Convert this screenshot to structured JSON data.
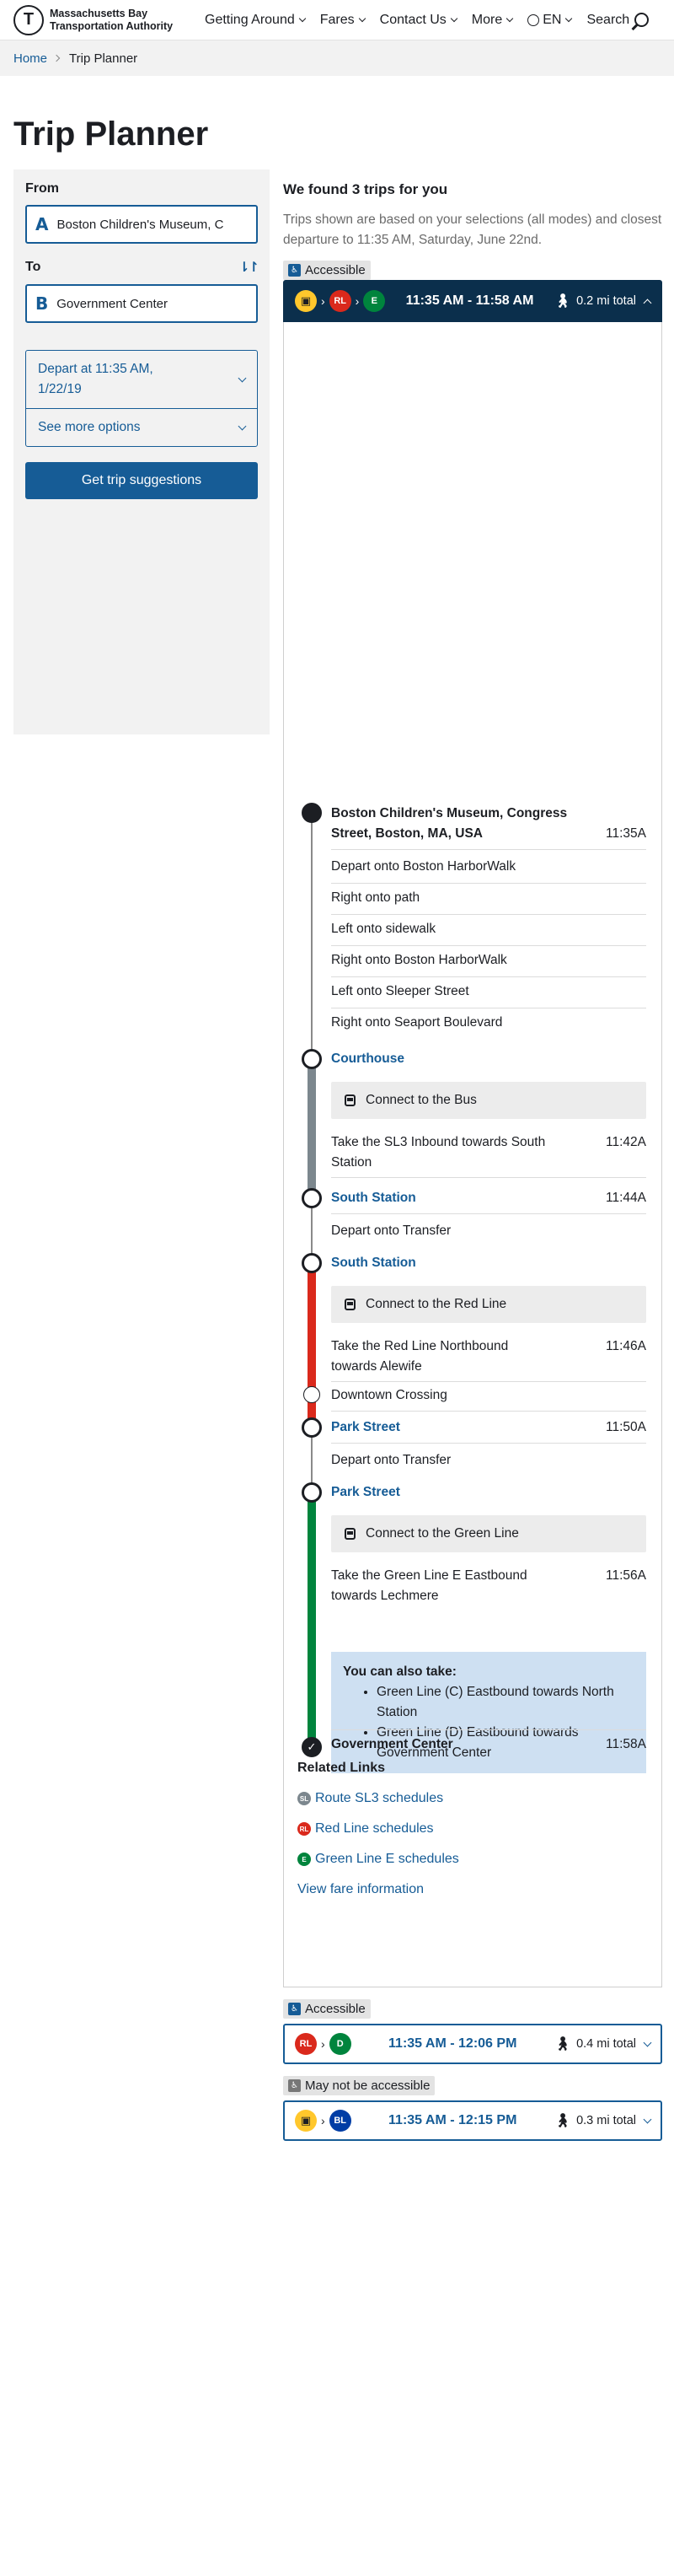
{
  "header": {
    "agency": "Massachusetts Bay Transportation Authority",
    "logo_letter": "T",
    "nav": [
      "Getting Around",
      "Fares",
      "Contact Us",
      "More"
    ],
    "lang": "EN",
    "search": "Search"
  },
  "breadcrumb": {
    "home": "Home",
    "current": "Trip Planner"
  },
  "page_title": "Trip Planner",
  "form": {
    "from_label": "From",
    "from_letter": "A",
    "from_value": "Boston Children's Museum, C",
    "to_label": "To",
    "swap": "⇂↾",
    "to_letter": "B",
    "to_value": "Government Center",
    "depart": "Depart at 11:35 AM, 1/22/19",
    "more_options": "See more options",
    "submit": "Get trip suggestions"
  },
  "results": {
    "title": "We found 3 trips for you",
    "description": "Trips shown are based on your selections (all modes) and closest departure to 11:35 AM, Saturday, June 22nd.",
    "trips": [
      {
        "accessibility": "Accessible",
        "modes": [
          "bus",
          "RL",
          "E"
        ],
        "time": "11:35 AM - 11:58 AM",
        "walk": "0.2 mi total"
      },
      {
        "accessibility": "Accessible",
        "modes": [
          "RL",
          "D"
        ],
        "time": "11:35 AM - 12:06 PM",
        "walk": "0.4 mi total"
      },
      {
        "accessibility": "May not be accessible",
        "modes": [
          "bus",
          "BL"
        ],
        "time": "11:35 AM - 12:15 PM",
        "walk": "0.3 mi total"
      }
    ]
  },
  "itinerary": {
    "origin": {
      "name": "Boston Children's Museum, Congress Street, Boston, MA, USA",
      "time": "11:35A"
    },
    "walk_steps": [
      "Depart onto Boston HarborWalk",
      "Right onto path",
      "Left onto sidewalk",
      "Right onto Boston HarborWalk",
      "Left onto Sleeper Street",
      "Right onto Seaport Boulevard"
    ],
    "courthouse": "Courthouse",
    "connect_bus": "Connect to the Bus",
    "bus_step": {
      "text": "Take the SL3 Inbound towards South Station",
      "time": "11:42A"
    },
    "south_station_1": {
      "name": "South Station",
      "time": "11:44A"
    },
    "transfer_1": "Depart onto Transfer",
    "south_station_2": "South Station",
    "connect_red": "Connect to the Red Line",
    "red_step": {
      "text": "Take the Red Line Northbound towards Alewife",
      "time": "11:46A"
    },
    "downtown": "Downtown Crossing",
    "park_street_1": {
      "name": "Park Street",
      "time": "11:50A"
    },
    "transfer_2": "Depart onto Transfer",
    "park_street_2": "Park Street",
    "connect_green": "Connect to the Green Line",
    "green_step": {
      "text": "Take the Green Line E Eastbound towards Lechmere",
      "time": "11:56A"
    },
    "also_title": "You can also take:",
    "also_items": [
      "Green Line (C) Eastbound towards North Station",
      "Green Line (D) Eastbound towards Government Center"
    ],
    "destination": {
      "name": "Government Center",
      "time": "11:58A"
    }
  },
  "related": {
    "title": "Related Links",
    "links": [
      "Route SL3 schedules",
      "Red Line schedules",
      "Green Line E schedules",
      "View fare information"
    ]
  },
  "colors": {
    "brand": "#165c96",
    "header_dark": "#0b2f4c",
    "red_line": "#da291c",
    "green_line": "#00843d",
    "blue_line": "#003da5",
    "bus": "#ffc72c",
    "silver": "#7c878e"
  }
}
